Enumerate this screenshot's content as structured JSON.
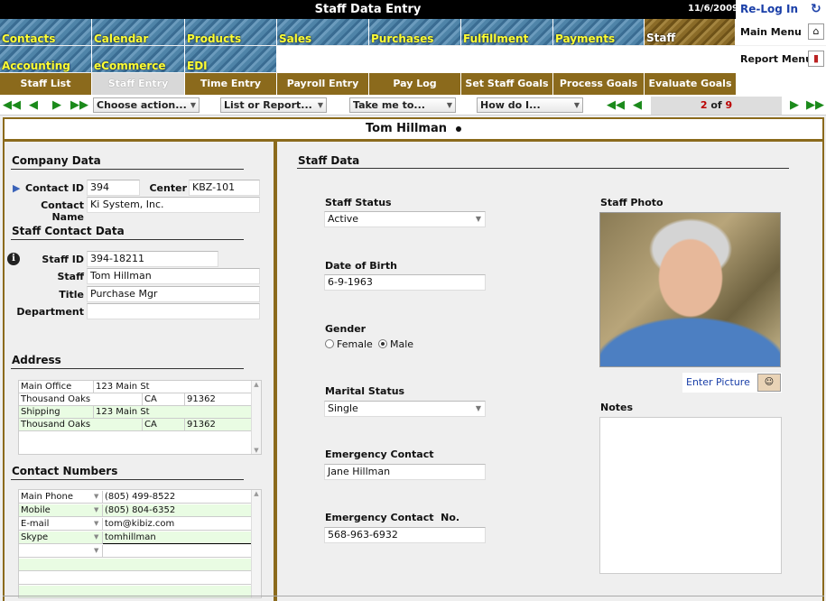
{
  "window": {
    "title": "Staff Data Entry",
    "date": "11/6/2009",
    "relog_label": "Re-Log In"
  },
  "modules": [
    "Contacts",
    "Calendar",
    "Products",
    "Sales",
    "Purchases",
    "Fulfillment",
    "Payments",
    "Staff",
    "Accounting",
    "eCommerce",
    "EDI"
  ],
  "side_links": {
    "main_menu": "Main Menu",
    "report_menu": "Report Menu"
  },
  "sub_tabs": [
    "Staff List",
    "Staff Entry",
    "Time Entry",
    "Payroll Entry",
    "Pay Log",
    "Set Staff Goals",
    "Process Goals",
    "Evaluate Goals"
  ],
  "nav": {
    "choose_action": "Choose action...",
    "list_report": "List or Report...",
    "take_me": "Take me to...",
    "how_do_i": "How do I...",
    "record_current": "2",
    "record_of": "of",
    "record_total": "9"
  },
  "header": {
    "name": "Tom Hillman"
  },
  "company": {
    "section": "Company Data",
    "contact_id_label": "Contact ID",
    "contact_id": "394",
    "center_label": "Center",
    "center": "KBZ-101",
    "contact_name_label": "Contact Name",
    "contact_name": "Ki System, Inc."
  },
  "staff_contact": {
    "section": "Staff Contact Data",
    "staff_id_label": "Staff ID",
    "staff_id": "394-18211",
    "staff_label": "Staff",
    "staff": "Tom Hillman",
    "title_label": "Title",
    "title": "Purchase Mgr",
    "department_label": "Department",
    "department": ""
  },
  "address": {
    "section": "Address",
    "rows": [
      [
        "Main Office",
        "123 Main St",
        "",
        ""
      ],
      [
        "Thousand Oaks",
        "",
        "CA",
        "91362"
      ],
      [
        "Shipping",
        "123 Main St",
        "",
        ""
      ],
      [
        "Thousand Oaks",
        "",
        "CA",
        "91362"
      ]
    ]
  },
  "contact_numbers": {
    "section": "Contact Numbers",
    "rows": [
      [
        "Main Phone",
        "(805) 499-8522"
      ],
      [
        "Mobile",
        "(805) 804-6352"
      ],
      [
        "E-mail",
        "tom@kibiz.com"
      ],
      [
        "Skype",
        "tomhillman"
      ],
      [
        "",
        ""
      ]
    ]
  },
  "staff_data": {
    "section": "Staff Data",
    "status_label": "Staff Status",
    "status": "Active",
    "dob_label": "Date of Birth",
    "dob": "6-9-1963",
    "gender_label": "Gender",
    "gender_female": "Female",
    "gender_male": "Male",
    "gender_selected": "Male",
    "marital_label": "Marital Status",
    "marital": "Single",
    "emergency_label": "Emergency Contact",
    "emergency": "Jane Hillman",
    "emergency_no_label": "Emergency Contact  No.",
    "emergency_no": "568-963-6932",
    "photo_label": "Staff Photo",
    "enter_picture": "Enter Picture",
    "notes_label": "Notes"
  }
}
